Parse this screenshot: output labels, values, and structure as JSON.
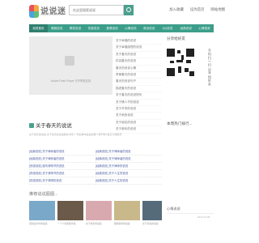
{
  "header": {
    "logo_text": "说说迷",
    "logo_sub": "shuoshuomi.com",
    "search_placeholder": "在这里搜索说说",
    "links": [
      "加入收藏",
      "设为首页",
      "网站地图"
    ]
  },
  "nav": {
    "items": [
      "说说首页",
      "情感说说",
      "搞笑说说",
      "伤感说说",
      "爱情说说",
      "心情说说",
      "原创说说",
      "QQ说说",
      "经典说说",
      "心情语录"
    ]
  },
  "flash": {
    "message": "Adobe Flash Player 已不再受支持"
  },
  "mid_list": {
    "items": [
      "关于幸福的说说",
      "关于幸福感悟的说说",
      "关于春天的说说",
      "形容春天的说说",
      "春天的说说心情",
      "赞美春天的说说",
      "春天的说说句子",
      "描述春天的说说",
      "关于春天的说说短句",
      "关于情人节的说说",
      "关于开学的说说",
      "关于雨的说说",
      "关于朋友的说说",
      "关于新年的说说"
    ]
  },
  "share": {
    "title": "分享给好友",
    "side_text": "手机 扫一扫 分享 给好友"
  },
  "section": {
    "title": "关于春天的说说",
    "desc": "关于春天的说说 关于春天的说说短句,你们一年四季中最喜欢哪个季节呢?春天万物复苏……",
    "left": [
      "[经典说说] 关于律师者的说说",
      "[经典说说] 关于律师者的说说",
      "[伤感说说] 描写清明节的说说",
      "[伤感说说] 关于清明节的说说",
      "[伤感说说] 关于清明的说说"
    ],
    "right": [
      "[经典说说] 关于律师者的说说",
      "[经典说说] 关于律师者的说说",
      "[经典说说] 关于律师的说说",
      "[经典说说] 关于人生的说说",
      "[经典说说] 关于人生的说说"
    ]
  },
  "right_panel": {
    "title": "本周热门排行..."
  },
  "pics": {
    "title": "推荐说说图图...",
    "captions": [
      "感谢生命中的说说",
      "一个人也能很幸福",
      "关于成长的说说",
      "致那些年的说说",
      "关于青春的说说"
    ],
    "colors": [
      "#7aa8c8",
      "#6b5a4a",
      "#d9a9b0",
      "#c9b88a",
      "#556b7a"
    ]
  },
  "right_foot": {
    "title": "心情说说",
    "date": "2017-07-05"
  }
}
